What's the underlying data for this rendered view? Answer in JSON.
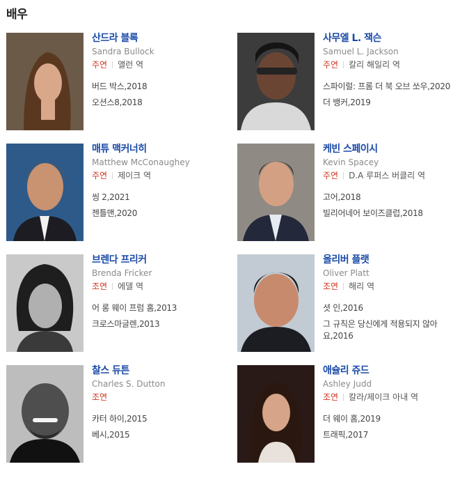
{
  "section": {
    "title": "배우"
  },
  "actors": [
    {
      "name_ko": "산드라 블록",
      "name_en": "Sandra Bullock",
      "role_type": "주연",
      "role": "앨런 역",
      "works": [
        "버드 박스,2018",
        "오션스8,2018"
      ],
      "photo_colors": {
        "bg": "#6b5a48",
        "hair": "#5a3820",
        "skin": "#d9a88a"
      }
    },
    {
      "name_ko": "사무엘 L. 잭슨",
      "name_en": "Samuel L. Jackson",
      "role_type": "주연",
      "role": "칼리 해일리 역",
      "works": [
        "스파이럴: 프롬 더 북 오브 쏘우,2020",
        "더 뱅커,2019"
      ],
      "photo_colors": {
        "bg": "#3c3c3c",
        "hair": "#141414",
        "skin": "#6b4533"
      }
    },
    {
      "name_ko": "매튜 맥커너히",
      "name_en": "Matthew McConaughey",
      "role_type": "주연",
      "role": "제이크 역",
      "works": [
        "씽 2,2021",
        "젠틀맨,2020"
      ],
      "photo_colors": {
        "bg": "#2e5a8a",
        "hair": "#6e5535",
        "skin": "#c99270"
      }
    },
    {
      "name_ko": "케빈 스페이시",
      "name_en": "Kevin Spacey",
      "role_type": "주연",
      "role": "D.A 루퍼스 버클리 역",
      "works": [
        "고어,2018",
        "빌리어네어 보이즈클럽,2018"
      ],
      "photo_colors": {
        "bg": "#8f8a84",
        "hair": "#4a3a2c",
        "skin": "#d3a083"
      }
    },
    {
      "name_ko": "브렌다 프리커",
      "name_en": "Brenda Fricker",
      "role_type": "조연",
      "role": "에델 역",
      "works": [
        "어 롱 웨이 프럼 홈,2013",
        "크로스마글렌,2013"
      ],
      "photo_colors": {
        "bg": "#c9c9c9",
        "hair": "#1e1e1e",
        "skin": "#b0b0b0"
      }
    },
    {
      "name_ko": "올리버 플랫",
      "name_en": "Oliver Platt",
      "role_type": "조연",
      "role": "해리 역",
      "works": [
        "셧 인,2016",
        "그 규칙은 당신에게 적용되지 않아요,2016"
      ],
      "photo_colors": {
        "bg": "#c2cbd3",
        "hair": "#1c1a18",
        "skin": "#c88a6c"
      }
    },
    {
      "name_ko": "찰스 듀튼",
      "name_en": "Charles S. Dutton",
      "role_type": "조연",
      "role": "",
      "works": [
        "카터 하이,2015",
        "베시,2015"
      ],
      "photo_colors": {
        "bg": "#bdbdbd",
        "hair": "#2a2a2a",
        "skin": "#4e4e4e"
      }
    },
    {
      "name_ko": "애슐리 쥬드",
      "name_en": "Ashley Judd",
      "role_type": "조연",
      "role": "칼라/제이크 아내 역",
      "works": [
        "더 웨이 홈,2019",
        "트래픽,2017"
      ],
      "photo_colors": {
        "bg": "#2a1a17",
        "hair": "#2a1810",
        "skin": "#d6a488"
      }
    }
  ]
}
